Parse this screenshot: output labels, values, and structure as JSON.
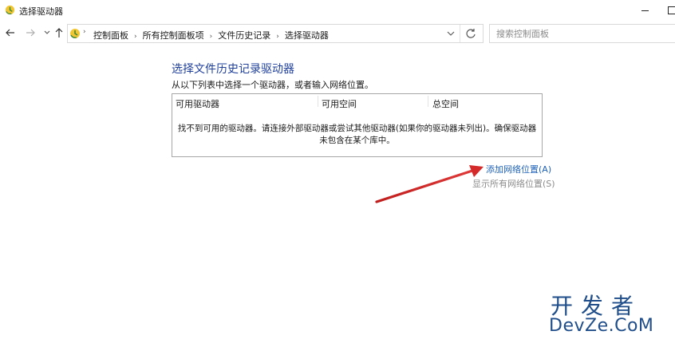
{
  "window": {
    "title": "选择驱动器"
  },
  "nav": {
    "back_icon": "arrow-left-icon",
    "forward_icon": "arrow-right-icon",
    "recent_icon": "chevron-down-icon",
    "up_icon": "arrow-up-icon"
  },
  "address": {
    "breadcrumbs": [
      "控制面板",
      "所有控制面板项",
      "文件历史记录",
      "选择驱动器"
    ],
    "dropdown_icon": "chevron-down-icon",
    "refresh_icon": "refresh-icon"
  },
  "search": {
    "placeholder": "搜索控制面板"
  },
  "main": {
    "title": "选择文件历史记录驱动器",
    "instruction": "从以下列表中选择一个驱动器，或者输入网络位置。",
    "columns": [
      "可用驱动器",
      "可用空间",
      "总空间"
    ],
    "empty_message": "找不到可用的驱动器。请连接外部驱动器或尝试其他驱动器(如果你的驱动器未列出)。确保驱动器未包含在某个库中。",
    "add_network_link": "添加网络位置(A)",
    "show_all_network_link": "显示所有网络位置(S)"
  },
  "colors": {
    "title_blue": "#1f3f9b",
    "link_blue": "#1f62b8",
    "annotation_red": "#d42a2a",
    "watermark_blue": "#1f4e8a"
  },
  "watermark": {
    "line1": "开发者",
    "line2": "DevZe.CoM"
  }
}
